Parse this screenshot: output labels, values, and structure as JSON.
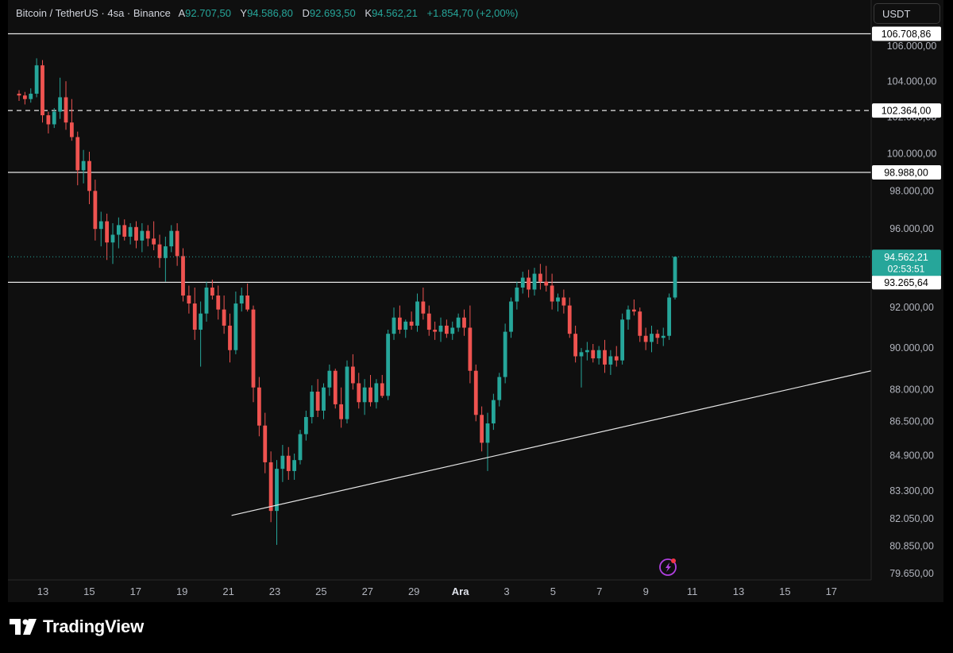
{
  "header": {
    "symbol": "Bitcoin / TetherUS · 4sa · Binance",
    "open_label": "A",
    "open": "92.707,50",
    "high_label": "Y",
    "high": "94.586,80",
    "low_label": "D",
    "low": "92.693,50",
    "close_label": "K",
    "close": "94.562,21",
    "change": "+1.854,70 (+2,00%)"
  },
  "currency_button": "USDT",
  "brand": "TradingView",
  "colors": {
    "up": "#26a69a",
    "down": "#ef5350",
    "background": "#0f0f0f",
    "text": "#d1d4dc"
  },
  "chart_data": {
    "type": "candlestick",
    "y_ticks": [
      "106.000,00",
      "104.000,00",
      "102.000,00",
      "100.000,00",
      "98.000,00",
      "96.000,00",
      "92.000,00",
      "90.000,00",
      "88.000,00",
      "86.500,00",
      "84.900,00",
      "83.300,00",
      "82.050,00",
      "80.850,00",
      "79.650,00"
    ],
    "x_ticks": [
      "13",
      "15",
      "17",
      "19",
      "21",
      "23",
      "25",
      "27",
      "29",
      "Ara",
      "3",
      "5",
      "7",
      "9",
      "11",
      "13",
      "15",
      "17"
    ],
    "y_scale": "log",
    "price_lines": [
      {
        "label": "106.708,86",
        "style": "solid"
      },
      {
        "label": "102.364,00",
        "style": "dashed"
      },
      {
        "label": "98.988,00",
        "style": "solid"
      },
      {
        "label": "93.265,64",
        "style": "solid"
      }
    ],
    "last_price": {
      "label": "94.562,21",
      "countdown": "02:53:51"
    },
    "trendline": {
      "from": {
        "x": "21",
        "y": 82200
      },
      "to": {
        "x": "17",
        "y": 88900
      }
    },
    "ohlc_series": [
      [
        103300,
        103500,
        102900,
        103200
      ],
      [
        103200,
        103400,
        102700,
        103000
      ],
      [
        103000,
        103600,
        102800,
        103300
      ],
      [
        103300,
        105300,
        103100,
        104900
      ],
      [
        104900,
        105200,
        101700,
        102100
      ],
      [
        102100,
        102300,
        101100,
        101600
      ],
      [
        101600,
        102500,
        101400,
        102300
      ],
      [
        102300,
        104200,
        101900,
        103100
      ],
      [
        103100,
        104000,
        101300,
        101700
      ],
      [
        101700,
        103000,
        100700,
        100900
      ],
      [
        100900,
        101200,
        98300,
        99100
      ],
      [
        99100,
        100200,
        98400,
        99600
      ],
      [
        99600,
        100100,
        97300,
        98000
      ],
      [
        98000,
        98600,
        95400,
        96000
      ],
      [
        96000,
        96900,
        95100,
        96400
      ],
      [
        96400,
        96800,
        94400,
        95300
      ],
      [
        95300,
        96300,
        94200,
        95700
      ],
      [
        95700,
        96600,
        95000,
        96200
      ],
      [
        96200,
        96500,
        95400,
        95600
      ],
      [
        95600,
        96300,
        95200,
        96100
      ],
      [
        96100,
        96400,
        95000,
        95400
      ],
      [
        95400,
        96300,
        94800,
        95900
      ],
      [
        95900,
        96200,
        95100,
        95500
      ],
      [
        95500,
        96400,
        94900,
        95200
      ],
      [
        95200,
        95700,
        94000,
        94500
      ],
      [
        94500,
        95600,
        93300,
        95100
      ],
      [
        95100,
        96200,
        94800,
        95900
      ],
      [
        95900,
        96300,
        94100,
        94600
      ],
      [
        94600,
        95000,
        92300,
        92600
      ],
      [
        92600,
        93100,
        91700,
        92200
      ],
      [
        92200,
        93000,
        90400,
        90900
      ],
      [
        90900,
        92300,
        89100,
        91700
      ],
      [
        91700,
        93300,
        91300,
        93000
      ],
      [
        93000,
        93400,
        92400,
        92600
      ],
      [
        92600,
        93100,
        91400,
        91900
      ],
      [
        91900,
        92600,
        90700,
        91100
      ],
      [
        91100,
        91700,
        89300,
        89900
      ],
      [
        89900,
        92800,
        89700,
        92200
      ],
      [
        92200,
        93000,
        91800,
        92600
      ],
      [
        92600,
        93200,
        91800,
        91900
      ],
      [
        91900,
        92100,
        87400,
        88100
      ],
      [
        88100,
        88600,
        85800,
        86300
      ],
      [
        86300,
        86900,
        84100,
        84600
      ],
      [
        84600,
        85100,
        81900,
        82400
      ],
      [
        82400,
        84700,
        80900,
        84300
      ],
      [
        84300,
        85400,
        83700,
        84900
      ],
      [
        84900,
        85300,
        83800,
        84200
      ],
      [
        84200,
        85000,
        83800,
        84700
      ],
      [
        84700,
        86100,
        84500,
        85900
      ],
      [
        85900,
        87000,
        85600,
        86700
      ],
      [
        86700,
        88200,
        86400,
        87900
      ],
      [
        87900,
        88500,
        86700,
        87000
      ],
      [
        87000,
        88300,
        86600,
        88100
      ],
      [
        88100,
        89200,
        87700,
        88900
      ],
      [
        88900,
        89000,
        87100,
        87300
      ],
      [
        87300,
        88100,
        86200,
        86600
      ],
      [
        86600,
        89400,
        86400,
        89100
      ],
      [
        89100,
        89700,
        88000,
        88300
      ],
      [
        88300,
        88800,
        87100,
        87400
      ],
      [
        87400,
        88500,
        86800,
        88100
      ],
      [
        88100,
        88700,
        87200,
        87400
      ],
      [
        87400,
        88500,
        87100,
        88300
      ],
      [
        88300,
        88700,
        87600,
        87700
      ],
      [
        87700,
        90900,
        87500,
        90700
      ],
      [
        90700,
        92000,
        90400,
        91500
      ],
      [
        91500,
        92100,
        90700,
        90900
      ],
      [
        90900,
        91400,
        90500,
        91300
      ],
      [
        91300,
        91800,
        90900,
        91100
      ],
      [
        91100,
        92700,
        90800,
        92300
      ],
      [
        92300,
        93000,
        91400,
        91700
      ],
      [
        91700,
        92100,
        90600,
        90900
      ],
      [
        90900,
        91300,
        90400,
        90800
      ],
      [
        90800,
        91500,
        90300,
        91100
      ],
      [
        91100,
        91400,
        90500,
        90700
      ],
      [
        90700,
        91300,
        90400,
        91000
      ],
      [
        91000,
        91700,
        90800,
        91500
      ],
      [
        91500,
        91900,
        90600,
        91000
      ],
      [
        91000,
        92100,
        88300,
        88900
      ],
      [
        88900,
        89200,
        86500,
        86800
      ],
      [
        86800,
        87200,
        85100,
        85500
      ],
      [
        85500,
        86900,
        84200,
        86400
      ],
      [
        86400,
        87800,
        86100,
        87500
      ],
      [
        87500,
        88800,
        87200,
        88600
      ],
      [
        88600,
        91200,
        88300,
        90800
      ],
      [
        90800,
        92500,
        90500,
        92300
      ],
      [
        92300,
        93300,
        91900,
        93000
      ],
      [
        93000,
        93800,
        92700,
        93500
      ],
      [
        93500,
        93900,
        92500,
        92900
      ],
      [
        92900,
        94000,
        92600,
        93700
      ],
      [
        93700,
        94200,
        92900,
        93300
      ],
      [
        93300,
        94100,
        92800,
        93100
      ],
      [
        93100,
        93700,
        91900,
        92300
      ],
      [
        92300,
        92700,
        91800,
        92500
      ],
      [
        92500,
        92900,
        91700,
        92100
      ],
      [
        92100,
        92500,
        90500,
        90700
      ],
      [
        90700,
        91100,
        89300,
        89600
      ],
      [
        89600,
        90000,
        88100,
        89800
      ],
      [
        89800,
        90300,
        89400,
        89900
      ],
      [
        89900,
        90200,
        89300,
        89500
      ],
      [
        89500,
        90100,
        89200,
        89900
      ],
      [
        89900,
        90400,
        88800,
        89200
      ],
      [
        89200,
        89900,
        88700,
        89600
      ],
      [
        89600,
        90100,
        89100,
        89400
      ],
      [
        89400,
        91700,
        89200,
        91400
      ],
      [
        91400,
        92100,
        90900,
        91900
      ],
      [
        91900,
        92400,
        91600,
        91800
      ],
      [
        91800,
        92000,
        90300,
        90600
      ],
      [
        90600,
        91000,
        89900,
        90300
      ],
      [
        90300,
        91100,
        89800,
        90700
      ],
      [
        90700,
        90900,
        90200,
        90500
      ],
      [
        90500,
        91000,
        90100,
        90600
      ],
      [
        90600,
        92700,
        90400,
        92500
      ],
      [
        92500,
        94586,
        92400,
        94562
      ]
    ]
  }
}
